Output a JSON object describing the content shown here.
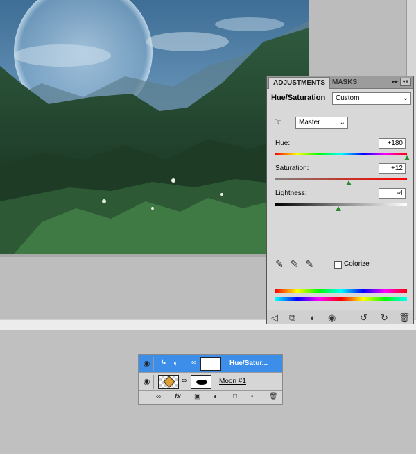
{
  "adjustments_panel": {
    "tabs": [
      "ADJUSTMENTS",
      "MASKS"
    ],
    "title": "Hue/Saturation",
    "preset": "Custom",
    "channel": "Master",
    "hue": {
      "label": "Hue:",
      "value": "+180",
      "fraction": 1.0
    },
    "saturation": {
      "label": "Saturation:",
      "value": "+12",
      "fraction": 0.56
    },
    "lightness": {
      "label": "Lightness:",
      "value": "-4",
      "fraction": 0.48
    },
    "colorize_label": "Colorize",
    "colorize_checked": false,
    "icons": {
      "collapse": "double-chevron-right-icon",
      "menu": "panel-menu-icon",
      "hand": "targeted-adjustment-icon",
      "eyedropper": "eyedropper-icon",
      "eyedropper_plus": "eyedropper-add-icon",
      "eyedropper_minus": "eyedropper-subtract-icon",
      "footer": [
        "back-arrow-icon",
        "expand-view-icon",
        "clip-layer-icon",
        "visibility-eye-icon",
        "view-previous-icon",
        "reset-icon",
        "trash-icon"
      ]
    }
  },
  "layers_panel": {
    "layers": [
      {
        "name": "Hue/Satur...",
        "selected": true
      },
      {
        "name": "Moon #1",
        "selected": false
      }
    ],
    "footer_icons": [
      "link-icon",
      "fx-icon",
      "mask-icon",
      "adjustment-icon",
      "folder-icon",
      "new-layer-icon",
      "trash-icon"
    ]
  },
  "colors": {
    "selection": "#3d8ee9",
    "panel_bg": "#d8d8d8",
    "slider_thumb": "#2a8a2a"
  }
}
